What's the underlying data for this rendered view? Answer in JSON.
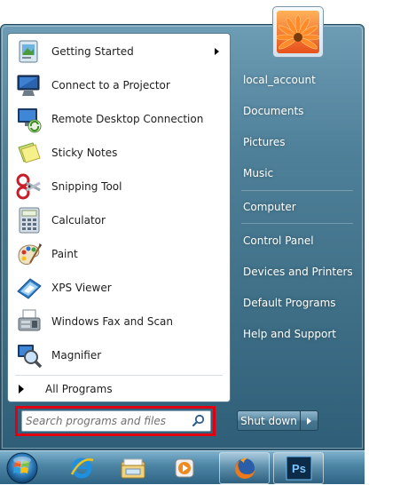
{
  "programs": [
    {
      "label": "Getting Started",
      "icon": "getting-started-icon",
      "has_submenu": true
    },
    {
      "label": "Connect to a Projector",
      "icon": "projector-icon"
    },
    {
      "label": "Remote Desktop Connection",
      "icon": "remote-desktop-icon"
    },
    {
      "label": "Sticky Notes",
      "icon": "sticky-notes-icon"
    },
    {
      "label": "Snipping Tool",
      "icon": "snipping-tool-icon"
    },
    {
      "label": "Calculator",
      "icon": "calculator-icon"
    },
    {
      "label": "Paint",
      "icon": "paint-icon"
    },
    {
      "label": "XPS Viewer",
      "icon": "xps-viewer-icon"
    },
    {
      "label": "Windows Fax and Scan",
      "icon": "fax-scan-icon"
    },
    {
      "label": "Magnifier",
      "icon": "magnifier-icon"
    }
  ],
  "all_programs_label": "All Programs",
  "search": {
    "placeholder": "Search programs and files",
    "value": ""
  },
  "right_pane": {
    "user_name": "local_account",
    "items": [
      "Documents",
      "Pictures",
      "Music",
      "Computer",
      "Control Panel",
      "Devices and Printers",
      "Default Programs",
      "Help and Support"
    ]
  },
  "shutdown": {
    "label": "Shut down"
  },
  "taskbar": {
    "items": [
      "start-orb-icon",
      "internet-explorer-icon",
      "windows-explorer-icon",
      "media-player-icon",
      "firefox-icon",
      "photoshop-icon"
    ],
    "photoshop_label": "Ps"
  },
  "colors": {
    "highlight_border": "#e10012",
    "menu_blue": "#3f7088"
  }
}
